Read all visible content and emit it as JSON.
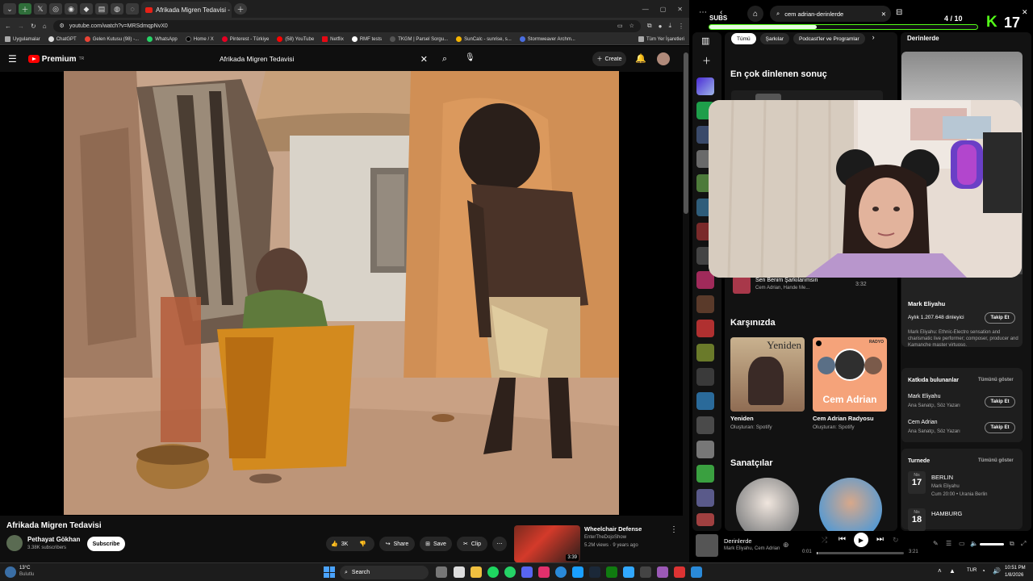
{
  "browser": {
    "active_tab_title": "Afrikada Migren Tedavisi -",
    "url": "youtube.com/watch?v=MRSdmqpNvX0",
    "bookmarks": [
      "Uygulamalar",
      "ChatGPT",
      "Gelen Kutusu (98) -...",
      "WhatsApp",
      "Home / X",
      "Pinterest - Türkiye",
      "(58) YouTube",
      "Netflix",
      "RMF tests",
      "TKGM | Parsel Sorgu...",
      "SunCalc - sunrise, s...",
      "Stormweaver Archm..."
    ],
    "all_bookmarks": "Tüm Yer İşaretleri"
  },
  "youtube": {
    "logo": "Premium",
    "logo_sup": "TR",
    "search_value": "Afrikada Migren Tedavisi",
    "create_label": "Create",
    "video_title": "Afrikada Migren Tedavisi",
    "channel_name": "Pethayat Gökhan",
    "subscribers": "3.38K subscribers",
    "subscribe_label": "Subscribe",
    "likes": "3K",
    "share_label": "Share",
    "save_label": "Save",
    "clip_label": "Clip",
    "rec_title": "Wheelchair Defense",
    "rec_channel": "EnterTheDojoShow",
    "rec_meta": "5.2M views · 9 years ago",
    "rec_duration": "3:39"
  },
  "spotify": {
    "search_value": "cem adrian-derinlerde",
    "chips": [
      "Tümü",
      "Şarkılar",
      "Podcast'ler ve Programlar"
    ],
    "top_result_heading": "En çok dinlenen sonuç",
    "song_row_title": "Sen Benim Şarkılarımsın",
    "song_row_artists": "Cem Adrian, Hande Me...",
    "song_row_duration": "3:32",
    "karsinizda_heading": "Karşınızda",
    "cards": [
      {
        "title": "Yeniden",
        "sub": "Oluşturan: Spotify",
        "art_text": "Yeniden"
      },
      {
        "title": "Cem Adrian Radyosu",
        "sub": "Oluşturan: Spotify",
        "art_text": "Cem Adrian",
        "badge": "RADYO"
      }
    ],
    "sanatcilar_heading": "Sanatçılar",
    "right_panel_title": "Derinlerde",
    "artist_name": "Mark Eliyahu",
    "monthly_listeners": "Aylık 1.207.648 dinleyici",
    "follow_label": "Takip Et",
    "artist_bio": "Mark Eliyahu: Ethnic-Electro sensation and charismatic live performer; composer, producer and Kamanche master virtuoso.",
    "credits_heading": "Katkıda bulunanlar",
    "show_all": "Tümünü göster",
    "credits": [
      {
        "name": "Mark Eliyahu",
        "role": "Ana Sanatçı, Söz Yazarı",
        "button": "Takip Et"
      },
      {
        "name": "Cem Adrian",
        "role": "Ana Sanatçı, Söz Yazarı",
        "button": "Takip Et"
      }
    ],
    "tour_heading": "Turnede",
    "tour": [
      {
        "month": "Nis",
        "day": "17",
        "city": "BERLIN",
        "line1": "Mark Eliyahu",
        "line2": "Cum 20:00 • Urania Berlin"
      },
      {
        "month": "Nis",
        "day": "18",
        "city": "HAMBURG",
        "line1": "",
        "line2": ""
      }
    ],
    "now_playing_title": "Derinlerde",
    "now_playing_artists": "Mark Eliyahu, Cem Adrian",
    "time_elapsed": "0:01",
    "time_total": "3:21",
    "progress": 0.005
  },
  "stream": {
    "subs_label": "SUBS",
    "subs_count": "4 / 10",
    "kick_number": "17",
    "subs_progress": 0.4
  },
  "taskbar": {
    "weather_temp": "13°C",
    "weather_desc": "Bulutlu",
    "search_label": "Search",
    "lang": "TUR",
    "time": "10:51 PM",
    "date": "1/8/2026"
  },
  "colors": {
    "yt_red": "#ff0000",
    "spotify_green": "#1ed760",
    "kick_green": "#53fc18"
  }
}
